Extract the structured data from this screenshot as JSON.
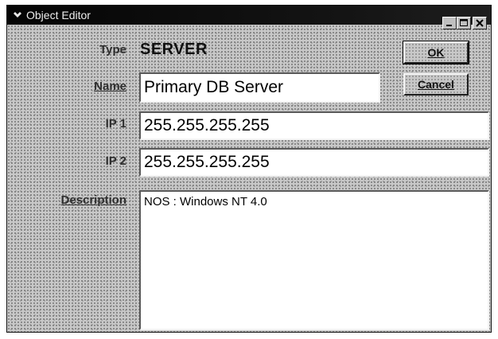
{
  "window": {
    "title": "Object Editor",
    "controls": [
      "minimize-icon",
      "maximize-icon",
      "close-icon"
    ]
  },
  "form": {
    "type_label": "Type",
    "type_value": "SERVER",
    "name_label": "Name",
    "name_value": "Primary DB Server",
    "ip1_label": "IP 1",
    "ip1_value": "255.255.255.255",
    "ip2_label": "IP 2",
    "ip2_value": "255.255.255.255",
    "description_label": "Description",
    "description_value": "NOS : Windows NT 4.0"
  },
  "buttons": {
    "ok_label": "OK",
    "cancel_label": "Cancel"
  },
  "colors": {
    "titlebar": "#0a0a0a",
    "window_bg": "#c8c8c8",
    "field_bg": "#ffffff"
  }
}
